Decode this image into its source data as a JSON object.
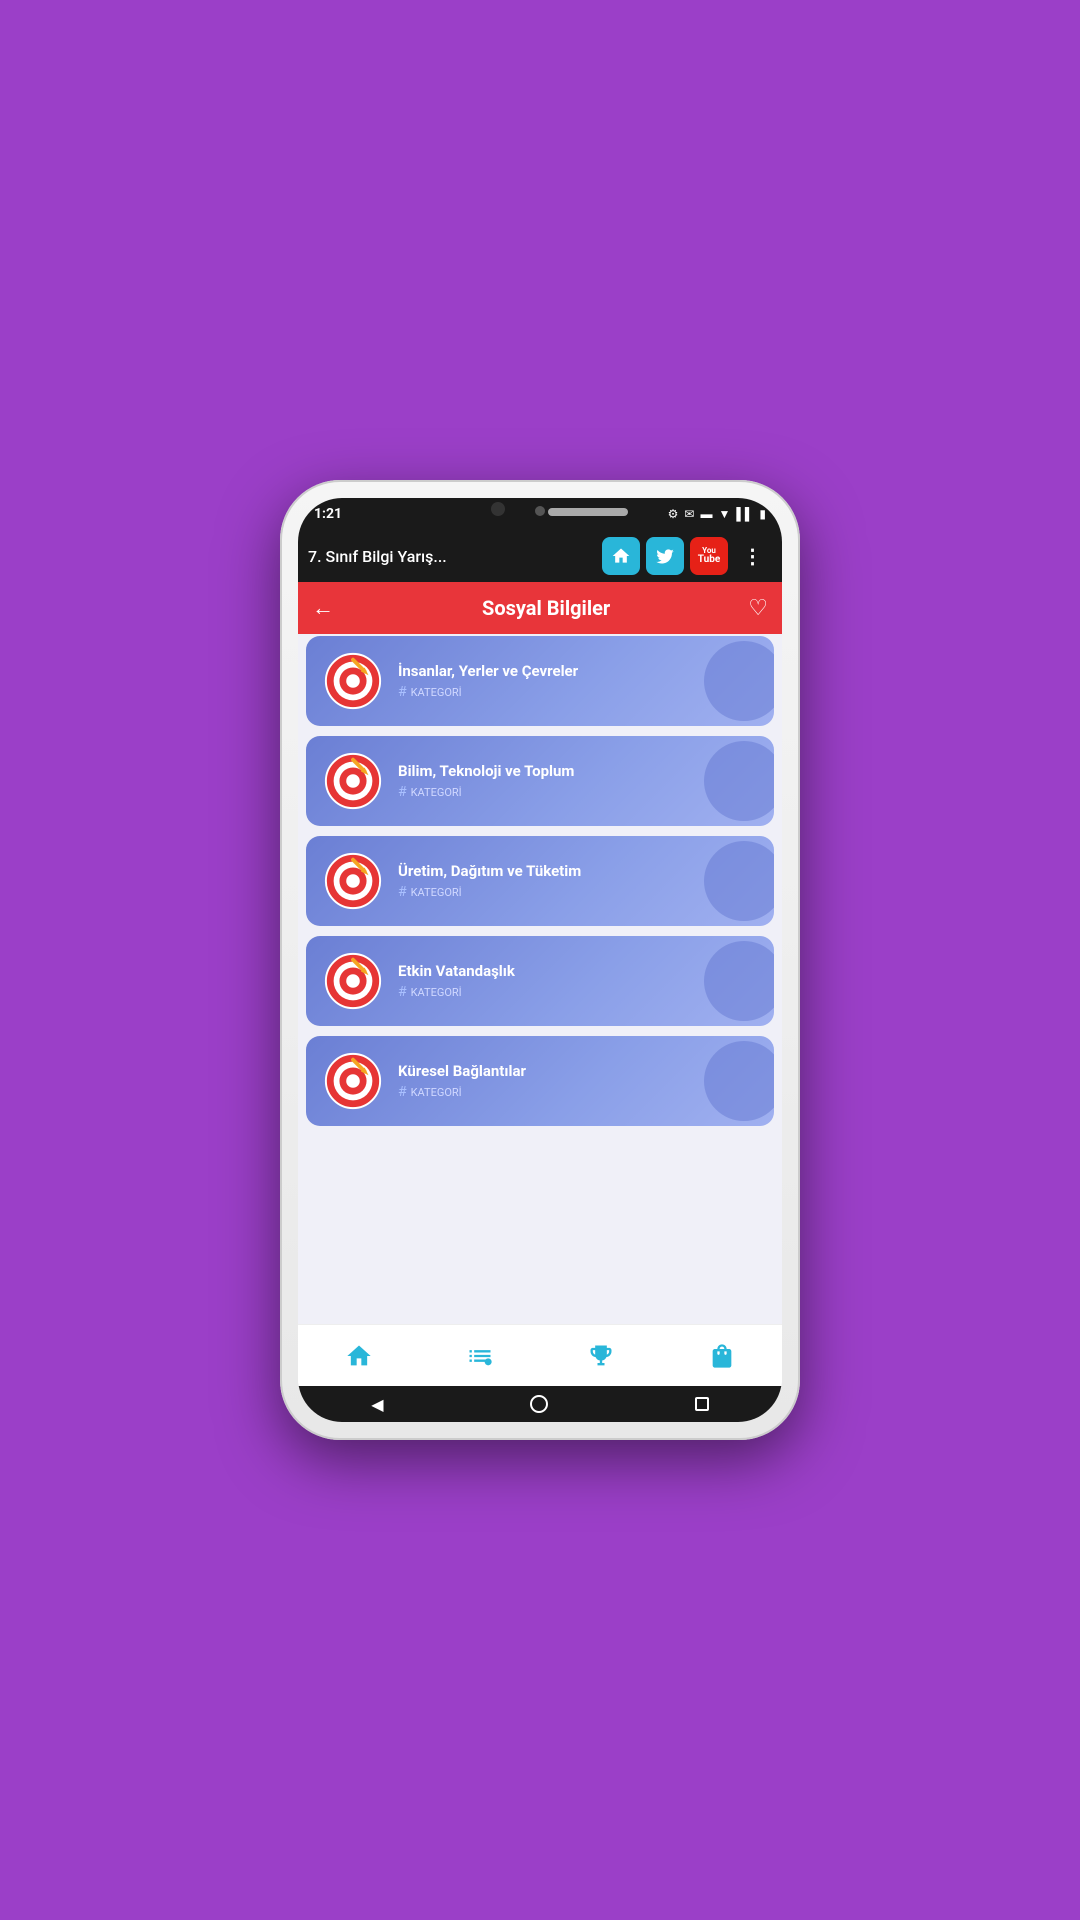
{
  "phone": {
    "statusBar": {
      "time": "1:21",
      "icons": [
        "⚙",
        "✉",
        "🔋"
      ]
    },
    "toolbar": {
      "title": "7. Sınıf Bilgi Yarış...",
      "homeLabel": "🏠",
      "twitterLabel": "t",
      "youtubeTopLabel": "You",
      "youtubeBotLabel": "Tube",
      "moreLabel": "⋮"
    },
    "pageHeader": {
      "title": "Sosyal Bilgiler",
      "backLabel": "←",
      "favoriteLabel": "♡"
    },
    "categories": [
      {
        "id": 1,
        "title": "İnsanlar, Yerler ve Çevreler",
        "subtitle": "KATEGORİ",
        "partial": true
      },
      {
        "id": 2,
        "title": "Bilim, Teknoloji ve Toplum",
        "subtitle": "KATEGORİ",
        "partial": false
      },
      {
        "id": 3,
        "title": "Üretim, Dağıtım ve Tüketim",
        "subtitle": "KATEGORİ",
        "partial": false
      },
      {
        "id": 4,
        "title": "Etkin Vatandaşlık",
        "subtitle": "KATEGORİ",
        "partial": false
      },
      {
        "id": 5,
        "title": "Küresel Bağlantılar",
        "subtitle": "KATEGORİ",
        "partial": false
      }
    ],
    "bottomNav": {
      "items": [
        {
          "icon": "🏠",
          "name": "home"
        },
        {
          "icon": "📋",
          "name": "list"
        },
        {
          "icon": "🏆",
          "name": "trophy"
        },
        {
          "icon": "🛍",
          "name": "shop"
        }
      ]
    }
  }
}
